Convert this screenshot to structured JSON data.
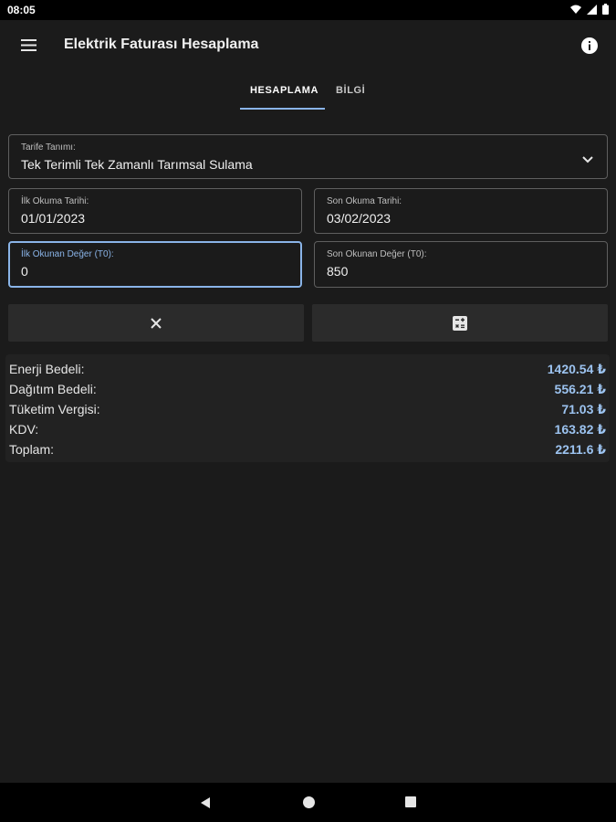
{
  "status_bar": {
    "time": "08:05"
  },
  "app_bar": {
    "title": "Elektrik Faturası Hesaplama"
  },
  "tabs": [
    {
      "label": "HESAPLAMA",
      "active": true
    },
    {
      "label": "BİLGİ",
      "active": false
    }
  ],
  "form": {
    "tariff": {
      "label": "Tarife Tanımı:",
      "value": "Tek Terimli Tek Zamanlı Tarımsal Sulama"
    },
    "first_read_date": {
      "label": "İlk Okuma Tarihi:",
      "value": "01/01/2023"
    },
    "last_read_date": {
      "label": "Son Okuma Tarihi:",
      "value": "03/02/2023"
    },
    "first_read_value": {
      "label": "İlk Okunan Değer (T0):",
      "value": "0"
    },
    "last_read_value": {
      "label": "Son Okunan Değer (T0):",
      "value": "850"
    }
  },
  "results": [
    {
      "label": "Enerji Bedeli:",
      "value": "1420.54 ₺"
    },
    {
      "label": "Dağıtım Bedeli:",
      "value": "556.21 ₺"
    },
    {
      "label": "Tüketim Vergisi:",
      "value": "71.03 ₺"
    },
    {
      "label": "KDV:",
      "value": "163.82 ₺"
    },
    {
      "label": "Toplam:",
      "value": "2211.6 ₺"
    }
  ],
  "colors": {
    "accent": "#8ab4e8",
    "value_text": "#9cc3f0",
    "background": "#1b1b1b"
  }
}
